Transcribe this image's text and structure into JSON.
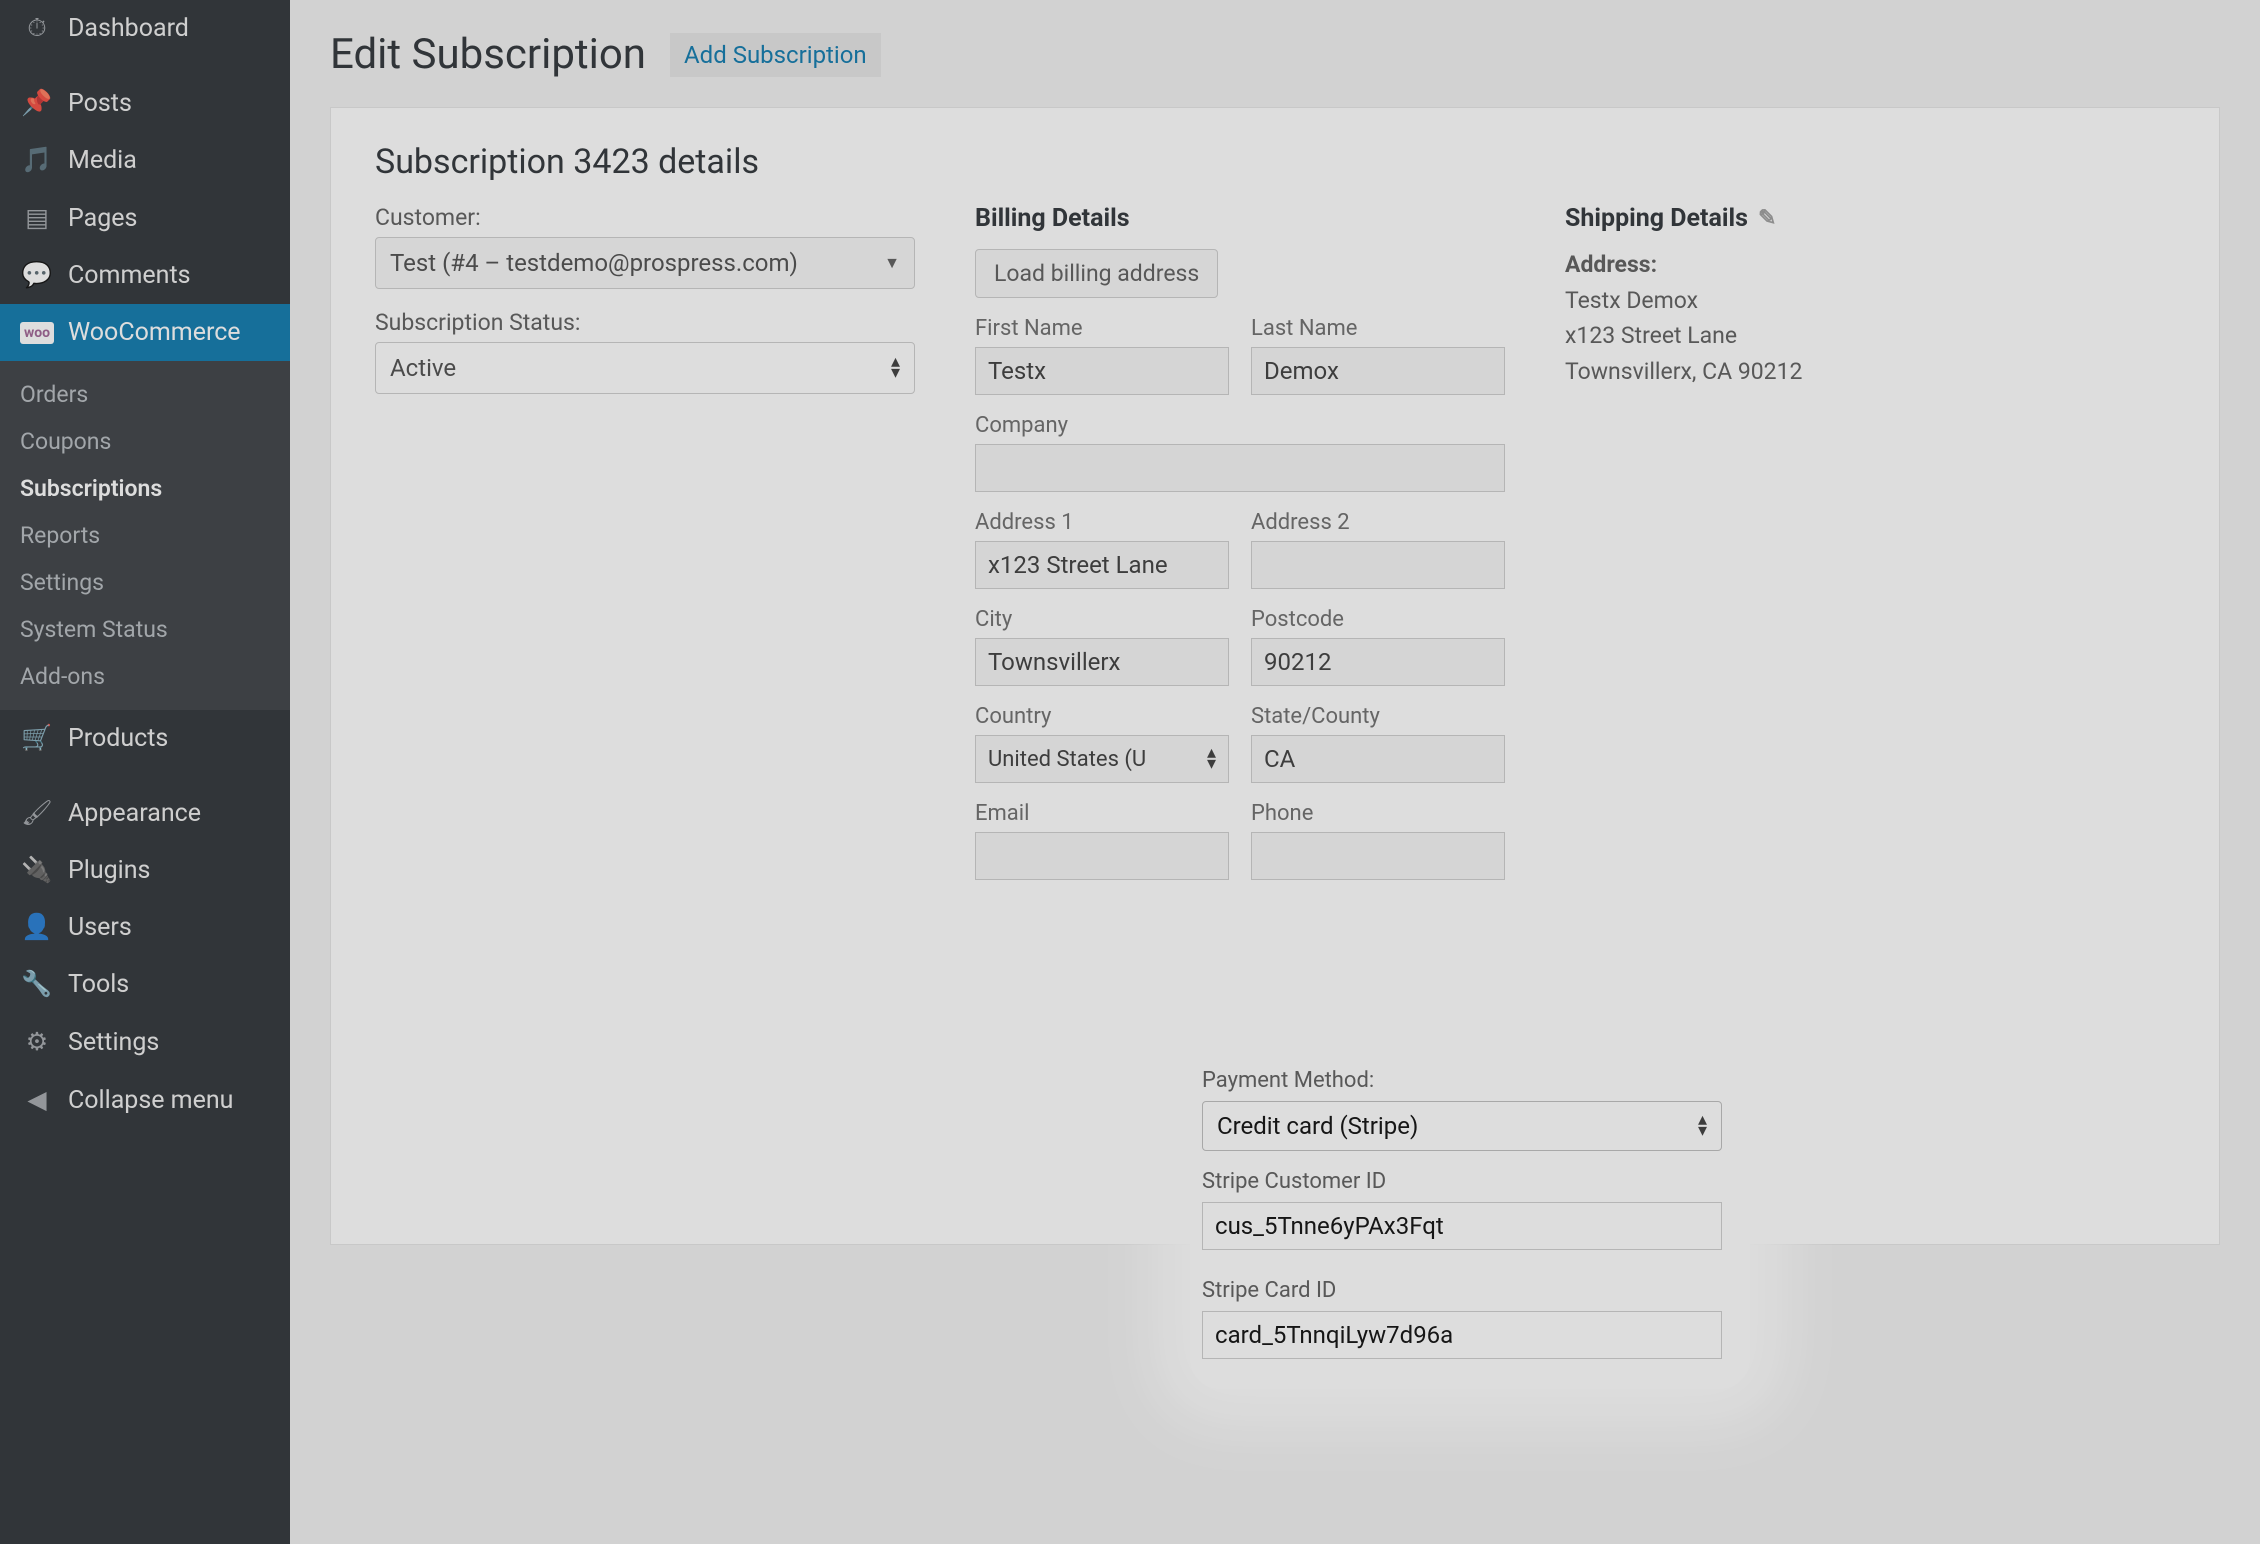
{
  "sidebar": {
    "items": [
      {
        "label": "Dashboard"
      },
      {
        "label": "Posts"
      },
      {
        "label": "Media"
      },
      {
        "label": "Pages"
      },
      {
        "label": "Comments"
      },
      {
        "label": "WooCommerce"
      },
      {
        "label": "Products"
      },
      {
        "label": "Appearance"
      },
      {
        "label": "Plugins"
      },
      {
        "label": "Users"
      },
      {
        "label": "Tools"
      },
      {
        "label": "Settings"
      },
      {
        "label": "Collapse menu"
      }
    ],
    "sub": [
      {
        "label": "Orders"
      },
      {
        "label": "Coupons"
      },
      {
        "label": "Subscriptions"
      },
      {
        "label": "Reports"
      },
      {
        "label": "Settings"
      },
      {
        "label": "System Status"
      },
      {
        "label": "Add-ons"
      }
    ]
  },
  "heading": {
    "title": "Edit Subscription",
    "add": "Add Subscription"
  },
  "panel": {
    "title": "Subscription 3423 details",
    "customer_label": "Customer:",
    "customer_value": "Test (#4 – testdemo@prospress.com)",
    "status_label": "Subscription Status:",
    "status_value": "Active"
  },
  "billing": {
    "title": "Billing Details",
    "load": "Load billing address",
    "first_name": {
      "label": "First Name",
      "value": "Testx"
    },
    "last_name": {
      "label": "Last Name",
      "value": "Demox"
    },
    "company": {
      "label": "Company",
      "value": ""
    },
    "address1": {
      "label": "Address 1",
      "value": "x123 Street Lane"
    },
    "address2": {
      "label": "Address 2",
      "value": ""
    },
    "city": {
      "label": "City",
      "value": "Townsvillerx"
    },
    "postcode": {
      "label": "Postcode",
      "value": "90212"
    },
    "country": {
      "label": "Country",
      "value": "United States (U"
    },
    "state": {
      "label": "State/County",
      "value": "CA"
    },
    "email": {
      "label": "Email",
      "value": ""
    },
    "phone": {
      "label": "Phone",
      "value": ""
    }
  },
  "shipping": {
    "title": "Shipping Details",
    "addr_label": "Address:",
    "line1": "Testx Demox",
    "line2": "x123 Street Lane",
    "line3": "Townsvillerx, CA 90212"
  },
  "payment": {
    "method_label": "Payment Method:",
    "method_value": "Credit card (Stripe)",
    "cust_label": "Stripe Customer ID",
    "cust_value": "cus_5Tnne6yPAx3Fqt",
    "card_label": "Stripe Card ID",
    "card_value": "card_5TnnqiLyw7d96a"
  }
}
